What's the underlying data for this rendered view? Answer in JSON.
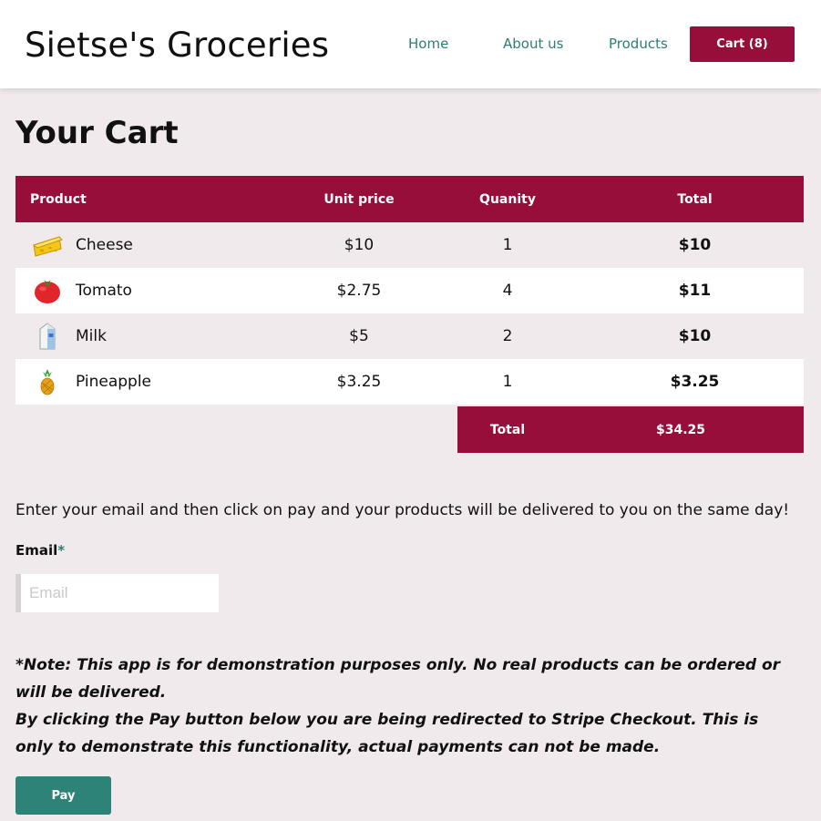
{
  "header": {
    "brand": "Sietse's Groceries",
    "nav": [
      {
        "label": "Home"
      },
      {
        "label": "About us"
      },
      {
        "label": "Products"
      }
    ],
    "cart_label": "Cart (8)"
  },
  "page_title": "Your Cart",
  "table": {
    "headers": {
      "product": "Product",
      "unit_price": "Unit price",
      "quantity": "Quanity",
      "total": "Total"
    },
    "rows": [
      {
        "icon": "cheese-icon",
        "product": "Cheese",
        "unit_price": "$10",
        "quantity": "1",
        "total": "$10"
      },
      {
        "icon": "tomato-icon",
        "product": "Tomato",
        "unit_price": "$2.75",
        "quantity": "4",
        "total": "$11"
      },
      {
        "icon": "milk-icon",
        "product": "Milk",
        "unit_price": "$5",
        "quantity": "2",
        "total": "$10"
      },
      {
        "icon": "pineapple-icon",
        "product": "Pineapple",
        "unit_price": "$3.25",
        "quantity": "1",
        "total": "$3.25"
      }
    ],
    "summary": {
      "label": "Total",
      "value": "$34.25"
    }
  },
  "form": {
    "instructions": "Enter your email and then click on pay and your products will be delivered to you on the same day!",
    "email_label": "Email",
    "email_required_mark": "*",
    "email_placeholder": "Email",
    "email_value": ""
  },
  "note": {
    "line1": "*Note: This app is for demonstration purposes only. No real products can be ordered or will be delivered.",
    "line2": "By clicking the Pay button below you are being redirected to Stripe Checkout. This is only to demonstrate this functionality, actual payments can not be made."
  },
  "pay_label": "Pay",
  "colors": {
    "accent": "#970e3b",
    "teal": "#2e8378",
    "background": "#f0eaed"
  }
}
